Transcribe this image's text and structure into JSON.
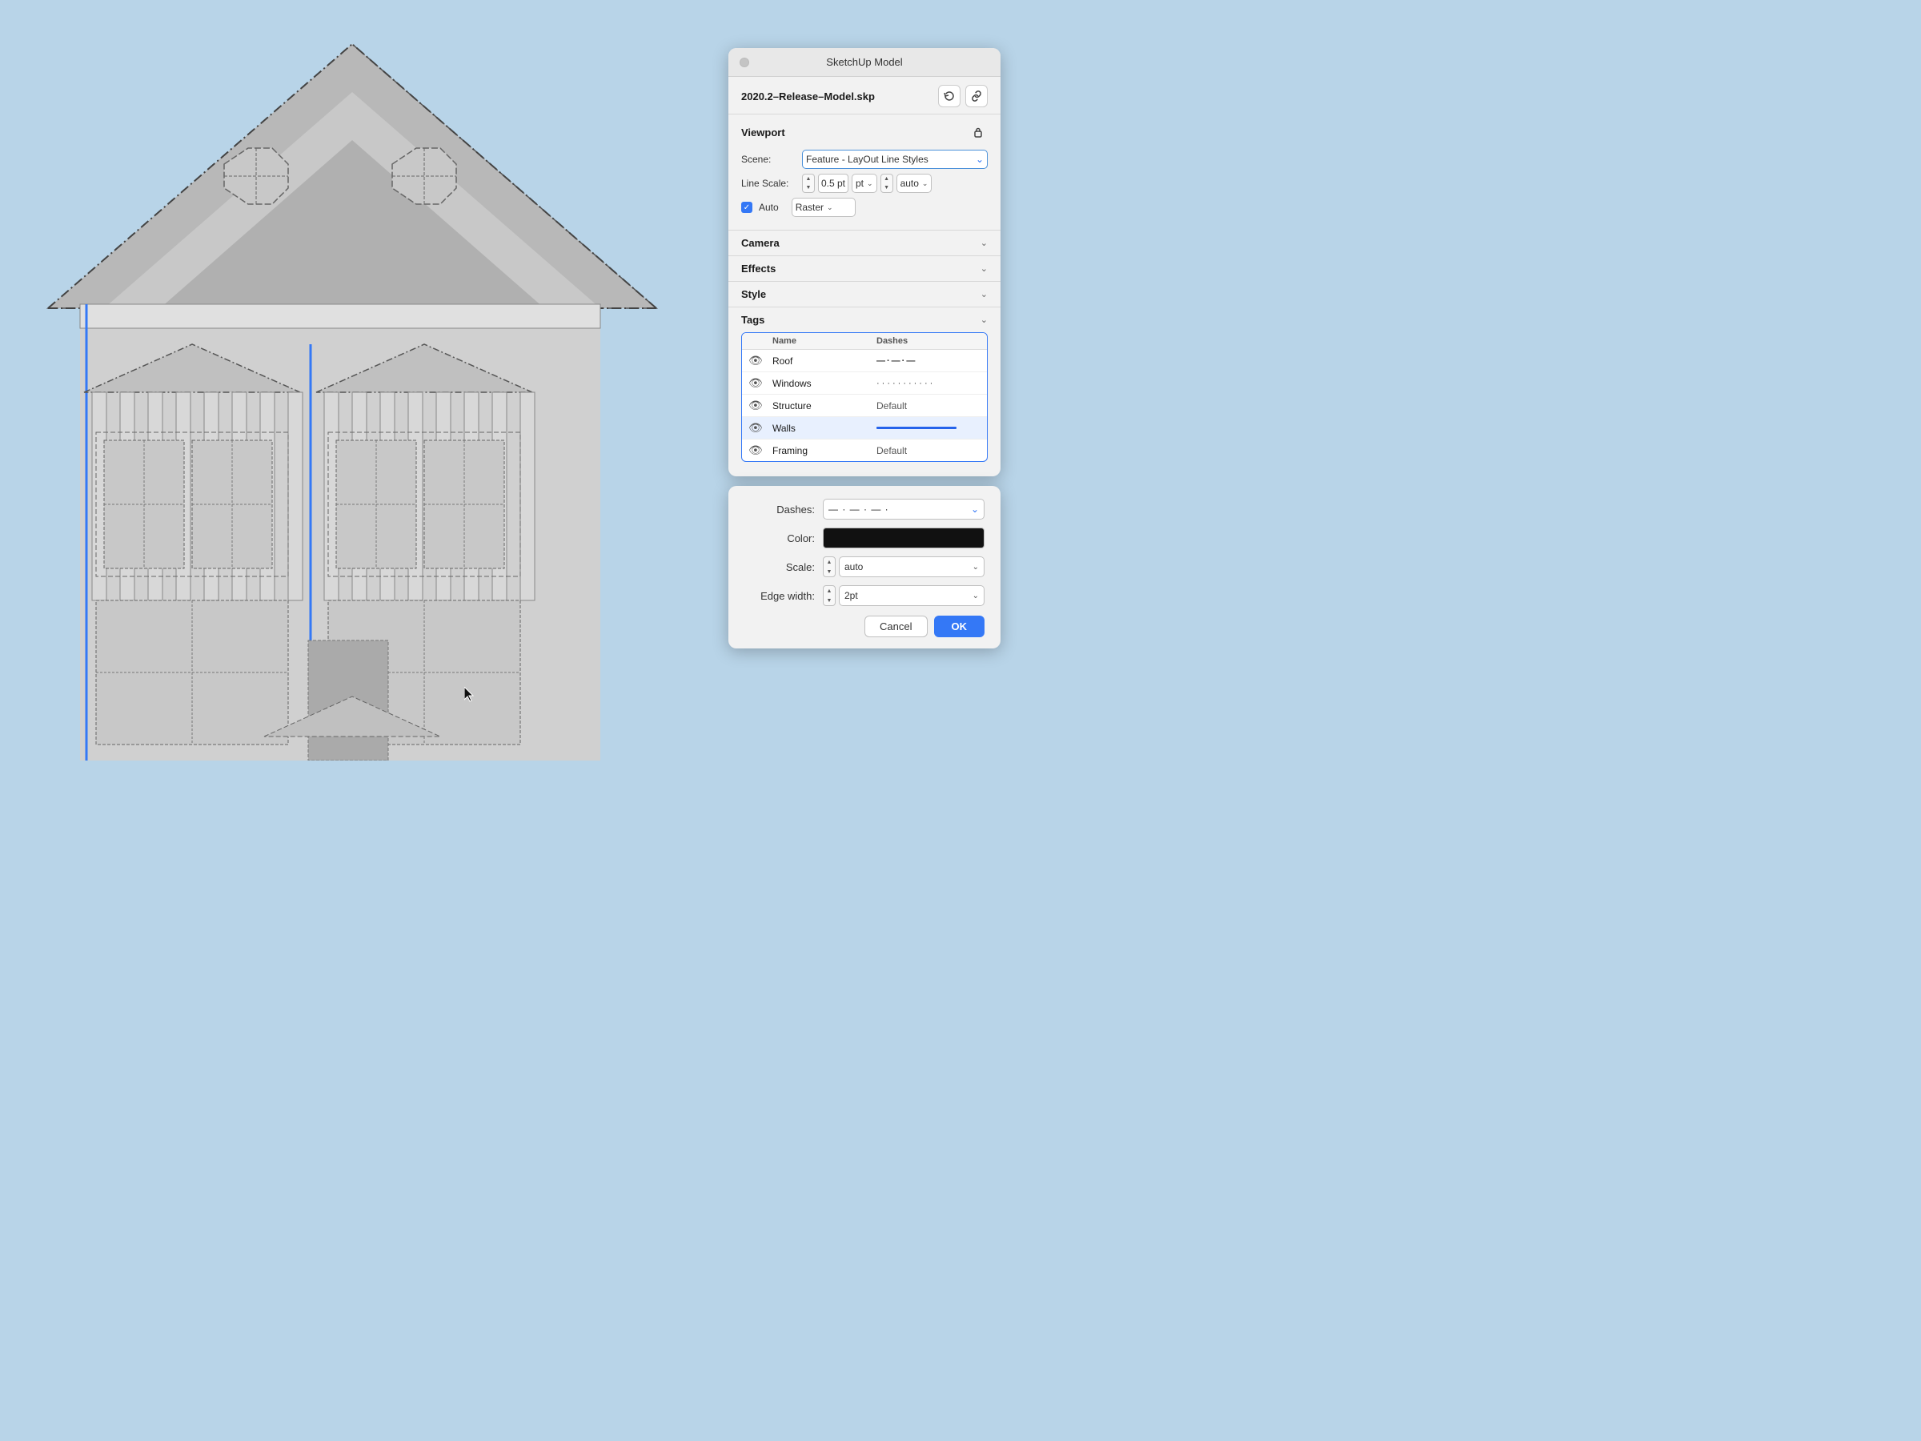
{
  "building": {
    "bg_color": "#b8d4e8"
  },
  "sketchup_panel": {
    "title": "SketchUp Model",
    "filename": "2020.2–Release–Model.skp",
    "refresh_icon": "↺",
    "link_icon": "🔗",
    "lock_icon": "🔒",
    "viewport_label": "Viewport",
    "scene_label": "Scene:",
    "scene_value": "Feature - LayOut Line Styles",
    "line_scale_label": "Line Scale:",
    "line_scale_value": "0.5 pt",
    "line_scale_unit": "pt",
    "line_scale_auto": "auto",
    "auto_label": "Auto",
    "render_mode": "Raster",
    "camera_label": "Camera",
    "effects_label": "Effects",
    "style_label": "Style",
    "tags_label": "Tags",
    "tags_table": {
      "col_name": "Name",
      "col_dashes": "Dashes",
      "rows": [
        {
          "name": "Roof",
          "dashes_type": "pattern",
          "dashes_label": "— · — · — ·"
        },
        {
          "name": "Windows",
          "dashes_type": "dots",
          "dashes_label": "· · · · · · · · · · ·"
        },
        {
          "name": "Structure",
          "dashes_type": "text",
          "dashes_label": "Default"
        },
        {
          "name": "Walls",
          "dashes_type": "solid-blue",
          "dashes_label": ""
        },
        {
          "name": "Framing",
          "dashes_type": "text",
          "dashes_label": "Default"
        }
      ]
    }
  },
  "tag_edit_dialog": {
    "dashes_label": "Dashes:",
    "dashes_value": "— · — · — ·",
    "color_label": "Color:",
    "scale_label": "Scale:",
    "scale_value": "auto",
    "edge_width_label": "Edge width:",
    "edge_width_value": "2pt",
    "cancel_label": "Cancel",
    "ok_label": "OK"
  }
}
